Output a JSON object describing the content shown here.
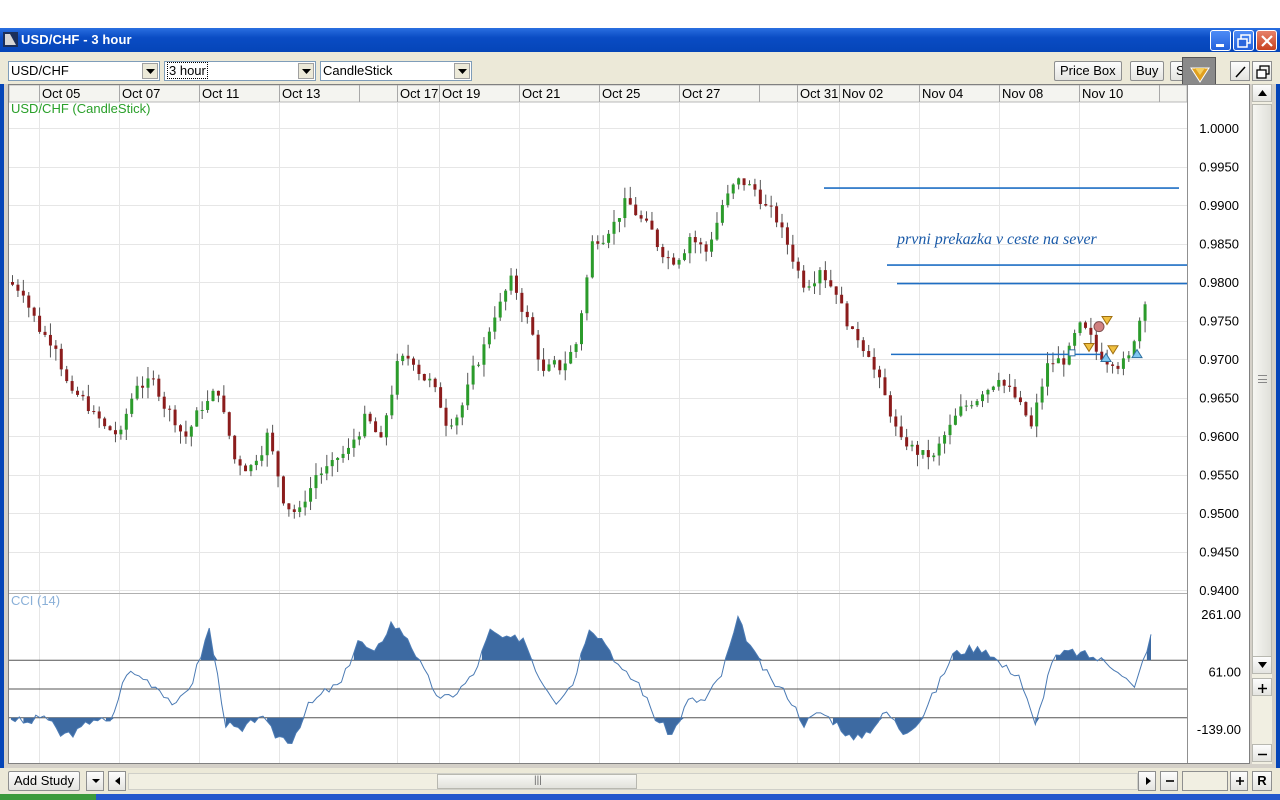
{
  "window": {
    "title": "USD/CHF - 3 hour"
  },
  "toolbar": {
    "symbol": "USD/CHF",
    "interval": "3 hour",
    "chart_type": "CandleStick",
    "price_box_label": "Price Box",
    "buy_label": "Buy",
    "sell_label": "Sell"
  },
  "chart": {
    "main_label": "USD/CHF (CandleStick)",
    "annotation": "prvni prekazka v ceste na sever",
    "date_labels": [
      "Oct 05",
      "Oct 07",
      "Oct 11",
      "Oct 13",
      "Oct 17",
      "Oct 19",
      "Oct 21",
      "Oct 25",
      "Oct 27",
      "Oct 31",
      "Nov 02",
      "Nov 04",
      "Nov 08",
      "Nov 10"
    ],
    "price_labels": [
      "1.0000",
      "0.9950",
      "0.9900",
      "0.9850",
      "0.9800",
      "0.9750",
      "0.9700",
      "0.9650",
      "0.9600",
      "0.9550",
      "0.9500",
      "0.9450",
      "0.9400"
    ],
    "cci_label": "CCI (14)",
    "cci_labels": [
      "261.00",
      "61.00",
      "-139.00"
    ],
    "colors": {
      "up": "#2b9b2b",
      "down": "#8b1c1c",
      "trendline": "#1f6fc4",
      "cci_fill": "#3d6aa2",
      "label_green": "#2aa02a",
      "annotation": "#1a5aa8"
    }
  },
  "chart_data": {
    "type": "candlestick",
    "series": [
      {
        "name": "USD/CHF (CandleStick)",
        "values": [
          0.979,
          0.974,
          0.972,
          0.965,
          0.964,
          0.961,
          0.96,
          0.967,
          0.967,
          0.963,
          0.96,
          0.964,
          0.966,
          0.957,
          0.956,
          0.96,
          0.952,
          0.95,
          0.955,
          0.956,
          0.958,
          0.962,
          0.959,
          0.969,
          0.97,
          0.967,
          0.962,
          0.964,
          0.97,
          0.976,
          0.98,
          0.975,
          0.968,
          0.969,
          0.972,
          0.985,
          0.987,
          0.99,
          0.988,
          0.985,
          0.983,
          0.986,
          0.984,
          0.99,
          0.993,
          0.992,
          0.989,
          0.985,
          0.98,
          0.982,
          0.979,
          0.973,
          0.971,
          0.965,
          0.959,
          0.958,
          0.957,
          0.961,
          0.964,
          0.966,
          0.968,
          0.965,
          0.961,
          0.969,
          0.97,
          0.974,
          0.971,
          0.97,
          0.97,
          0.978
        ]
      },
      {
        "name": "CCI (14)",
        "values": [
          -100,
          -120,
          -90,
          -160,
          -150,
          -100,
          -120,
          60,
          40,
          0,
          -60,
          30,
          210,
          -120,
          -150,
          -90,
          -160,
          -180,
          -60,
          -10,
          20,
          170,
          120,
          230,
          180,
          60,
          -40,
          -10,
          50,
          200,
          170,
          180,
          40,
          -40,
          20,
          220,
          160,
          60,
          20,
          -100,
          -160,
          -40,
          -40,
          50,
          240,
          120,
          30,
          -20,
          -120,
          -80,
          -120,
          -180,
          -140,
          -80,
          -150,
          -110,
          0,
          120,
          140,
          140,
          80,
          50,
          -130,
          100,
          130,
          120,
          100,
          70,
          0,
          190
        ]
      }
    ],
    "ylim": [
      0.94,
      1.0
    ],
    "cci_ylim": [
      -139,
      261
    ],
    "xlabel": "",
    "ylabel": "",
    "grid": true
  }
}
